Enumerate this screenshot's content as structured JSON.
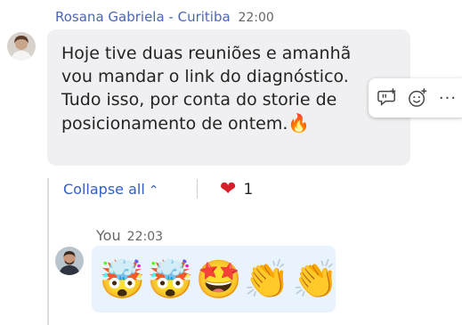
{
  "incoming": {
    "sender": "Rosana Gabriela - Curitiba",
    "time": "22:00",
    "line1": "Hoje tive duas reuniões e amanhã",
    "line2": "vou mandar o link do diagnóstico.",
    "line3": "Tudo isso,  por conta do storie de",
    "line4": "posicionamento de ontem.",
    "emoji": "🔥"
  },
  "thread": {
    "collapse_label": "Collapse all",
    "chevron": "⌃",
    "reaction_emoji": "❤",
    "reaction_count": "1"
  },
  "reply": {
    "sender": "You",
    "time": "22:03",
    "emojis": [
      "🤯",
      "🤯",
      "🤩",
      "👏",
      "👏"
    ]
  },
  "hover_actions": {
    "more": "···"
  },
  "icons": {
    "reply": "reply-with-quote-icon",
    "react": "add-reaction-icon",
    "more": "more-options-icon"
  },
  "colors": {
    "sender": "#4a66b8",
    "link": "#2f5fc4",
    "incoming_bubble": "#f0f0f2",
    "outgoing_bubble": "#e8f3fd",
    "heart": "#d4202a"
  }
}
